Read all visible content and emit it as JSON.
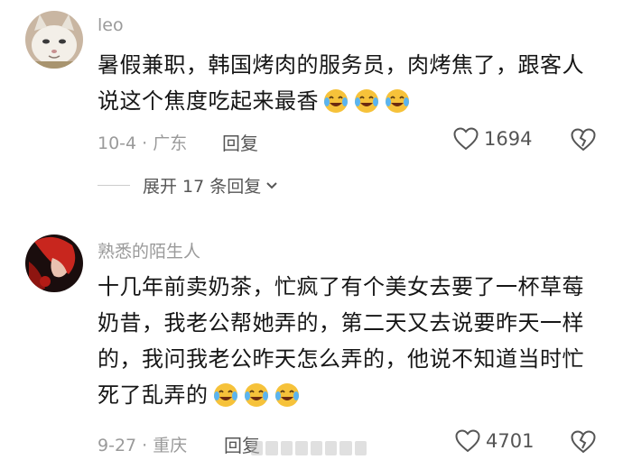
{
  "comments": [
    {
      "username": "leo",
      "text": "暑假兼职，韩国烤肉的服务员，肉烤焦了，跟客人说这个焦度吃起来最香",
      "emojis": [
        "crying-laughing-emoji",
        "crying-laughing-emoji",
        "crying-laughing-emoji"
      ],
      "date_location": "10-4 · 广东",
      "reply_label": "回复",
      "like_count": "1694",
      "expand_label": "展开 17 条回复"
    },
    {
      "username": "熟悉的陌生人",
      "text": "十几年前卖奶茶，忙疯了有个美女去要了一杯草莓奶昔，我老公帮她弄的，第二天又去说要昨天一样的，我问我老公昨天怎么弄的，他说不知道当时忙死了乱弄的",
      "emojis": [
        "crying-laughing-emoji",
        "crying-laughing-emoji",
        "crying-laughing-emoji"
      ],
      "date_location": "9-27 · 重庆",
      "reply_label": "回复",
      "like_count": "4701"
    }
  ],
  "colors": {
    "text": "#161616",
    "meta": "#9a9a9a",
    "action": "#555555"
  }
}
